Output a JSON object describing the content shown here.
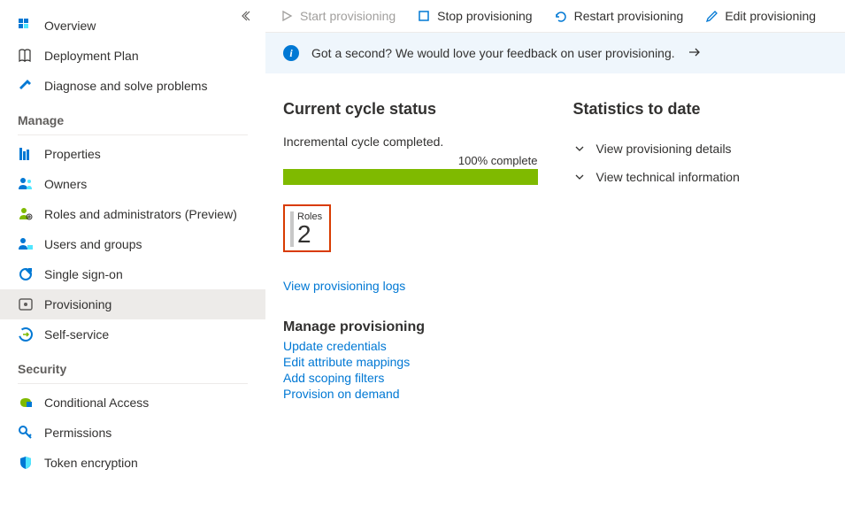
{
  "sidebar": {
    "top": [
      {
        "label": "Overview",
        "icon": "overview"
      },
      {
        "label": "Deployment Plan",
        "icon": "deployment"
      },
      {
        "label": "Diagnose and solve problems",
        "icon": "diagnose"
      }
    ],
    "manage_header": "Manage",
    "manage": [
      {
        "label": "Properties",
        "icon": "properties"
      },
      {
        "label": "Owners",
        "icon": "owners"
      },
      {
        "label": "Roles and administrators (Preview)",
        "icon": "roles"
      },
      {
        "label": "Users and groups",
        "icon": "usersgroups"
      },
      {
        "label": "Single sign-on",
        "icon": "sso"
      },
      {
        "label": "Provisioning",
        "icon": "provisioning",
        "selected": true
      },
      {
        "label": "Self-service",
        "icon": "selfservice"
      }
    ],
    "security_header": "Security",
    "security": [
      {
        "label": "Conditional Access",
        "icon": "conditional"
      },
      {
        "label": "Permissions",
        "icon": "permissions"
      },
      {
        "label": "Token encryption",
        "icon": "token"
      }
    ]
  },
  "toolbar": {
    "start": "Start provisioning",
    "stop": "Stop provisioning",
    "restart": "Restart provisioning",
    "edit": "Edit provisioning"
  },
  "feedback": {
    "text": "Got a second? We would love your feedback on user provisioning."
  },
  "status": {
    "heading": "Current cycle status",
    "text": "Incremental cycle completed.",
    "progress_label": "100% complete",
    "roles_label": "Roles",
    "roles_value": "2",
    "logs_link": "View provisioning logs"
  },
  "manage_prov": {
    "heading": "Manage provisioning",
    "links": [
      "Update credentials",
      "Edit attribute mappings",
      "Add scoping filters",
      "Provision on demand"
    ]
  },
  "stats": {
    "heading": "Statistics to date",
    "rows": [
      "View provisioning details",
      "View technical information"
    ]
  }
}
